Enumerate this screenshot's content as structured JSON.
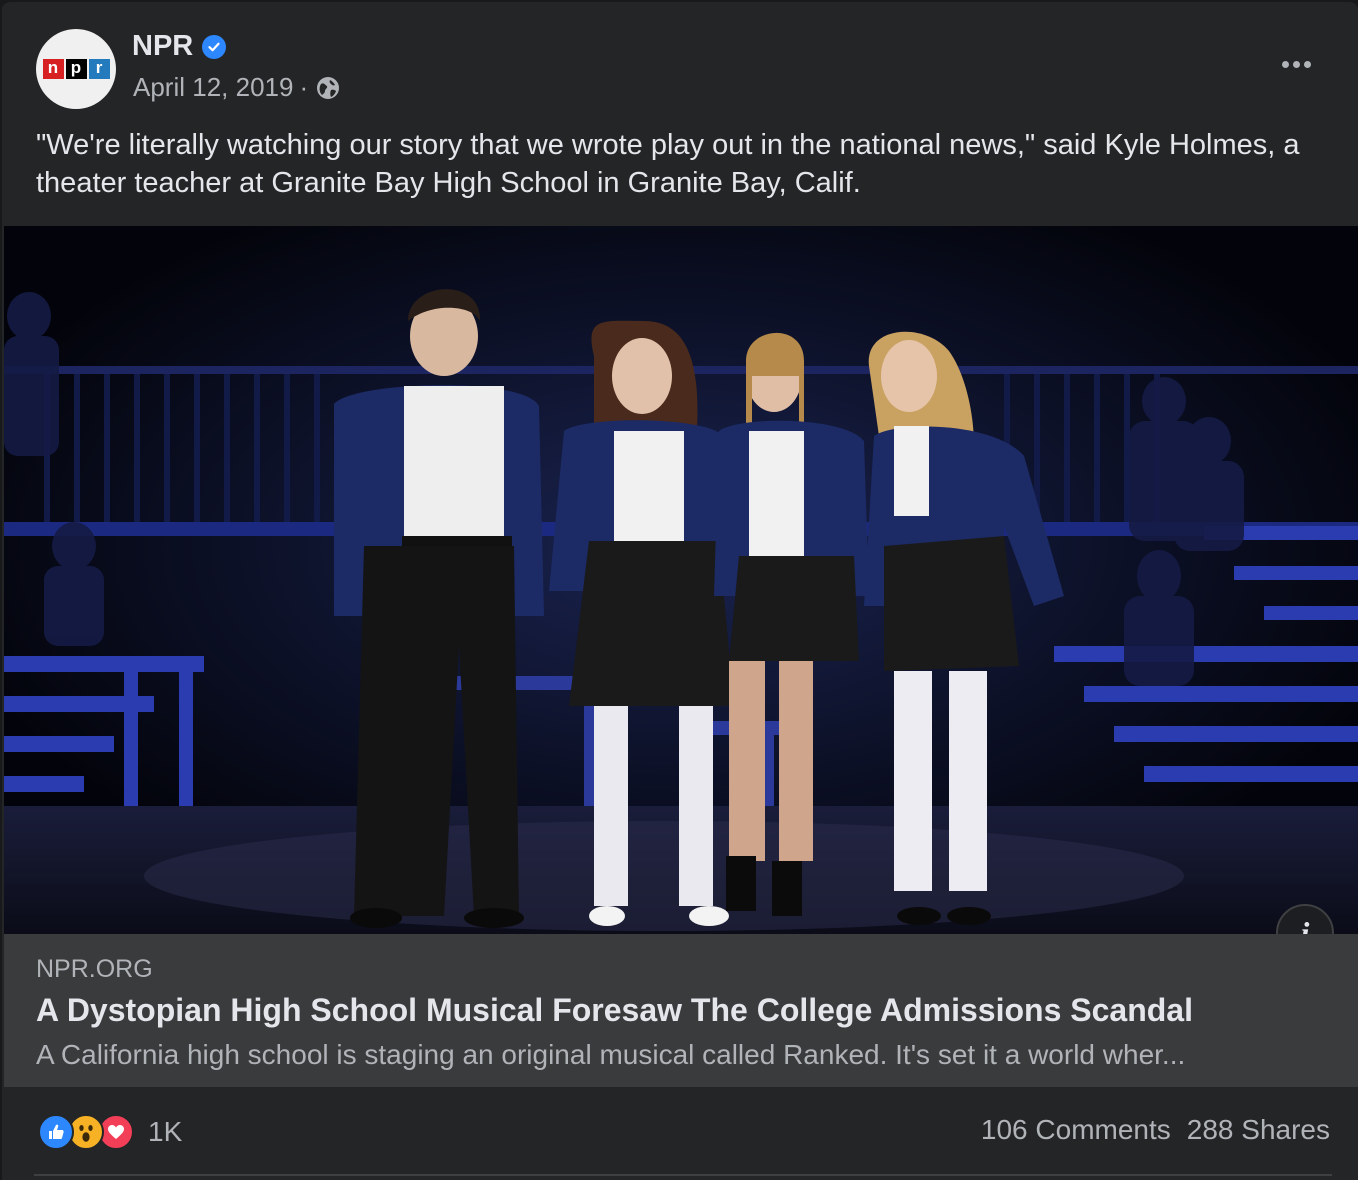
{
  "post": {
    "author": "NPR",
    "avatar_logo_letters": [
      "n",
      "p",
      "r"
    ],
    "date": "April 12, 2019",
    "separator": "·",
    "privacy_icon": "globe-icon",
    "verified_icon": "verified-badge-icon",
    "more_icon": "more-options-icon",
    "text": "\"We're literally watching our story that we wrote play out in the national news,\" said Kyle Holmes, a theater teacher at Granite Bay High School in Granite Bay, Calif."
  },
  "media": {
    "info_label": "i"
  },
  "link": {
    "domain": "NPR.ORG",
    "title": "A Dystopian High School Musical Foresaw The College Admissions Scandal",
    "description": "A California high school is staging an original musical called Ranked. It's set it a world wher..."
  },
  "footer": {
    "reaction_icons": [
      "like-icon",
      "wow-icon",
      "love-icon"
    ],
    "reaction_count": "1K",
    "comments": "106 Comments",
    "shares": "288 Shares"
  },
  "colors": {
    "background": "#242526",
    "link_box": "#3a3b3c",
    "verified": "#2d88ff",
    "like": "#2d88ff",
    "love": "#f33e58",
    "wow": "#f7b125"
  }
}
